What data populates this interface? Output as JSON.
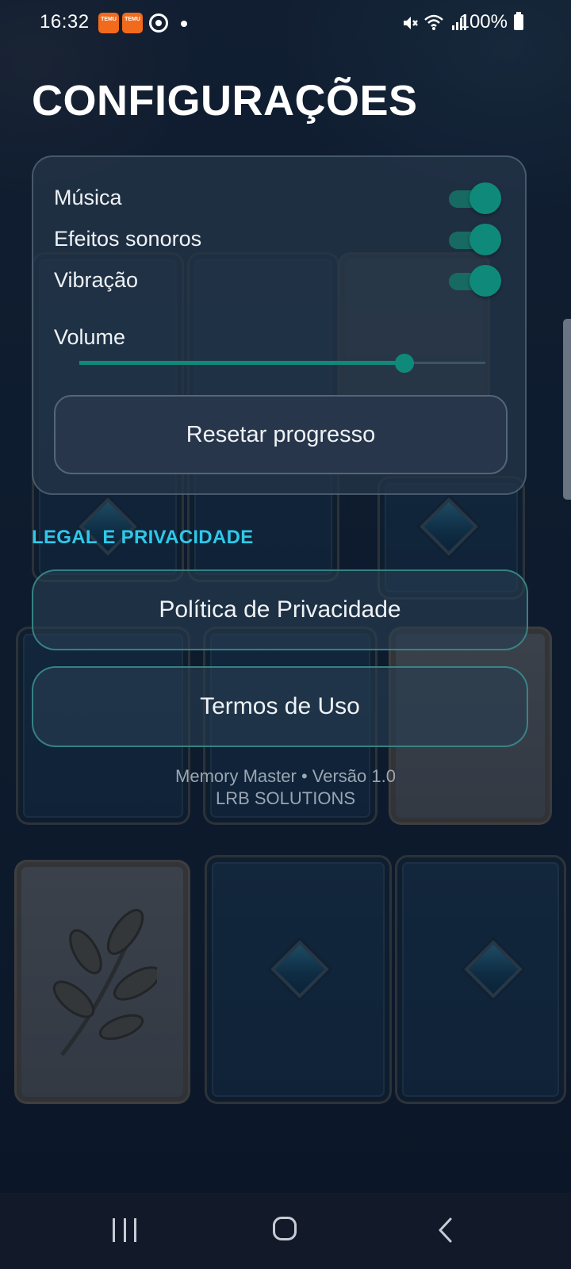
{
  "status_bar": {
    "time": "16:32",
    "battery": "100%",
    "app_icon_text": "TEMU"
  },
  "page": {
    "title": "CONFIGURAÇÕES"
  },
  "settings": {
    "toggles": [
      {
        "label": "Música",
        "on": true
      },
      {
        "label": "Efeitos sonoros",
        "on": true
      },
      {
        "label": "Vibração",
        "on": true
      }
    ],
    "volume_label": "Volume",
    "volume_level": 0.8,
    "reset_label": "Resetar progresso"
  },
  "legal": {
    "heading": "LEGAL E PRIVACIDADE",
    "privacy_label": "Política de Privacidade",
    "terms_label": "Termos de Uso"
  },
  "footer": {
    "app_version": "Memory Master • Versão 1.0",
    "company": "LRB SOLUTIONS"
  },
  "colors": {
    "accent": "#0f8a7a",
    "section_heading": "#2ec9e8",
    "text": "#eef2f6"
  },
  "icons": {
    "status": [
      "temu-icon",
      "temu-icon",
      "sync-icon",
      "dot-icon",
      "mute-icon",
      "wifi-icon",
      "signal-icon",
      "battery-icon"
    ],
    "nav": [
      "recent-apps-icon",
      "home-icon",
      "back-icon"
    ]
  }
}
